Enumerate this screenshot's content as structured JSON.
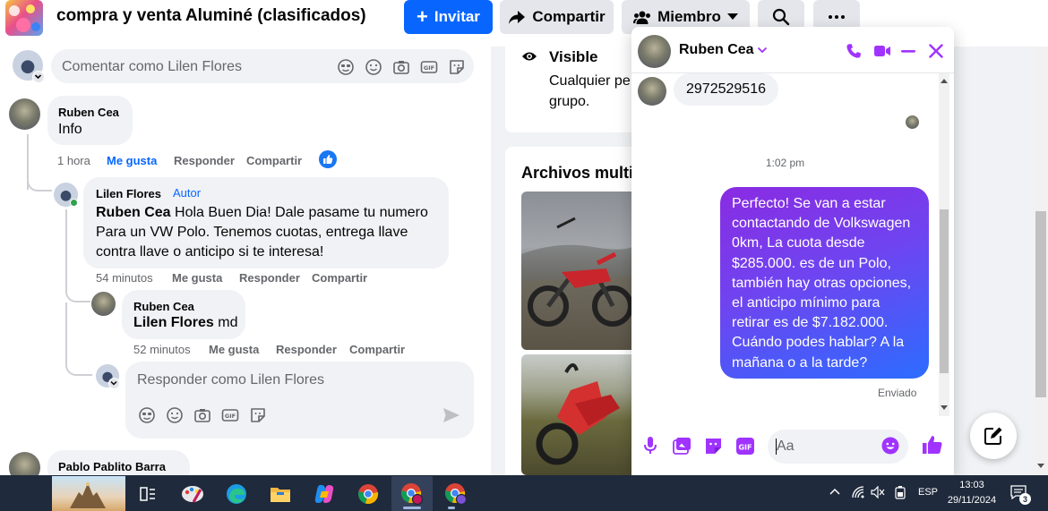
{
  "header": {
    "group_title": "compra y venta Aluminé (clasificados)",
    "invite_label": "Invitar",
    "share_label": "Compartir",
    "member_label": "Miembro"
  },
  "feed": {
    "comment_placeholder": "Comentar como Lilen Flores",
    "comments": [
      {
        "author": "Ruben Cea",
        "text": "Info",
        "time": "1 hora",
        "like": "Me gusta",
        "reply": "Responder",
        "share": "Compartir"
      },
      {
        "author": "Lilen Flores",
        "author_badge": "Autor",
        "mention": "Ruben Cea",
        "text": "Hola Buen Dia! Dale pasame tu numero Para un VW Polo. Tenemos cuotas, entrega llave contra llave o anticipo si te interesa!",
        "time": "54 minutos",
        "like": "Me gusta",
        "reply": "Responder",
        "share": "Compartir"
      },
      {
        "author": "Ruben Cea",
        "mention": "Lilen Flores",
        "text": "md",
        "time": "52 minutos",
        "like": "Me gusta",
        "reply": "Responder",
        "share": "Compartir"
      }
    ],
    "reply_placeholder": "Responder como Lilen Flores",
    "next_comment_author": "Pablo Pablito Barra"
  },
  "sidebar": {
    "visibility_title": "Visible",
    "visibility_desc_line1": "Cualquier pe",
    "visibility_desc_line2": "grupo.",
    "media_title": "Archivos multi"
  },
  "chat": {
    "contact_name": "Ruben Cea",
    "incoming_message": "2972529516",
    "timestamp": "1:02 pm",
    "outgoing_message": "Perfecto!  Se van a estar contactando de Volkswagen 0km, La cuota desde $285.000. es de un Polo, también hay otras opciones, el anticipo mínimo para retirar es de $7.182.000. Cuándo podes hablar? A la mañana o a la tarde?",
    "status": "Enviado",
    "input_placeholder": "Aa",
    "accent_color": "#a033ff"
  },
  "taskbar": {
    "language": "ESP",
    "time": "13:03",
    "date": "29/11/2024",
    "notification_count": "3"
  }
}
